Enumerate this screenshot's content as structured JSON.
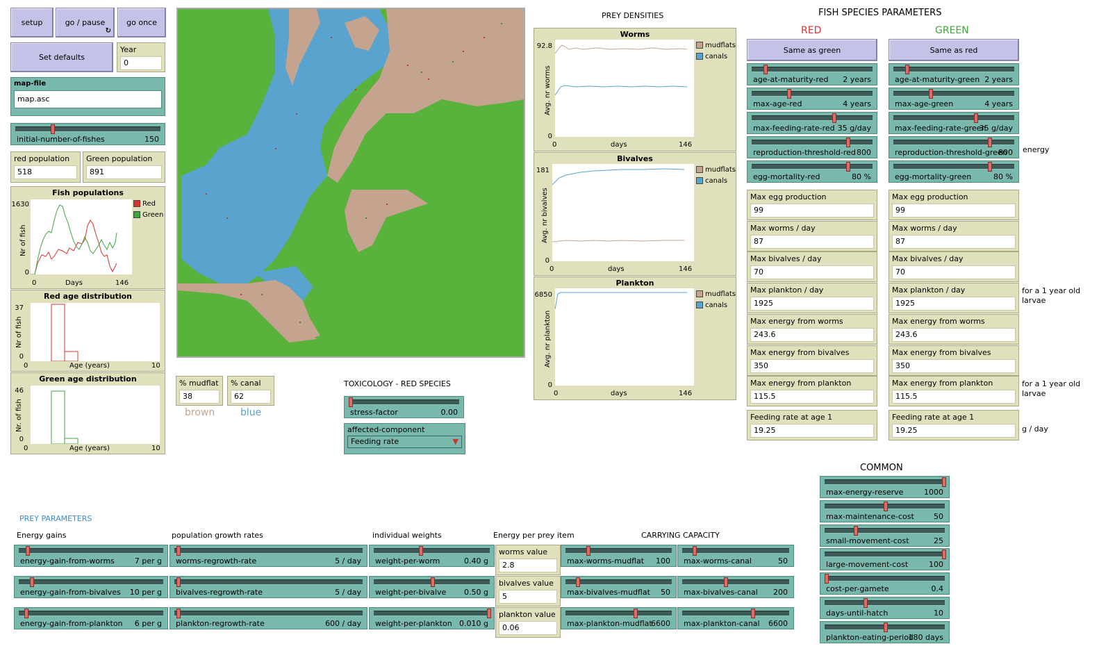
{
  "buttons": {
    "setup": "setup",
    "go_pause": "go / pause",
    "go_once": "go once",
    "set_defaults": "Set defaults",
    "same_as_green": "Same as green",
    "same_as_red": "Same as red"
  },
  "year": {
    "label": "Year",
    "value": "0"
  },
  "map_file": {
    "label": "map-file",
    "value": "map.asc"
  },
  "initial_fishes": {
    "label": "initial-number-of-fishes",
    "value": "150",
    "fraction": 0.25
  },
  "red_population": {
    "label": "red population",
    "value": "518"
  },
  "green_population": {
    "label": "Green population",
    "value": "891"
  },
  "fish_plot": {
    "title": "Fish populations",
    "ylabel": "Nr of fish",
    "xlabel": "Days",
    "ymax": "1630",
    "ymin": "0",
    "xmin": "0",
    "xmax": "146",
    "legend_red": "Red",
    "legend_green": "Green"
  },
  "red_age": {
    "title": "Red age distribution",
    "ylabel": "Nr of fish",
    "xlabel": "Age (years)",
    "ymax": "37",
    "ymin": "0",
    "xmin": "0",
    "xmax": "10"
  },
  "green_age": {
    "title": "Green age distribution",
    "ylabel": "Nr. of fish",
    "xlabel": "Age (years)",
    "ymax": "46",
    "ymin": "0",
    "xmin": "0",
    "xmax": "10"
  },
  "mudflat": {
    "label": "% mudflat",
    "value": "38",
    "caption": "brown"
  },
  "canal": {
    "label": "% canal",
    "value": "62",
    "caption": "blue"
  },
  "toxicology": {
    "title": "TOXICOLOGY - RED SPECIES",
    "stress_label": "stress-factor",
    "stress_value": "0.00",
    "stress_fraction": 0.0,
    "affected_label": "affected-component",
    "affected_value": "Feeding rate"
  },
  "prey_densities_title": "PREY DENSITIES",
  "worms_plot": {
    "title": "Worms",
    "ylabel": "Avg. nr worms",
    "xlabel": "days",
    "ymax": "92.8",
    "ymin": "0",
    "xmin": "0",
    "xmax": "146"
  },
  "bivalves_plot": {
    "title": "Bivalves",
    "ylabel": "Avg. nr bivalves",
    "xlabel": "days",
    "ymax": "181",
    "ymin": "0",
    "xmin": "0",
    "xmax": "146"
  },
  "plankton_plot": {
    "title": "Plankton",
    "ylabel": "Avg. nr plankton",
    "xlabel": "days",
    "ymax": "6850",
    "ymin": "0",
    "xmin": "0",
    "xmax": "146"
  },
  "prey_legend": {
    "mudflats": "mudflats",
    "canals": "canals"
  },
  "fish_params": {
    "title": "FISH SPECIES PARAMETERS",
    "red_header": "RED",
    "green_header": "GREEN",
    "red_sliders": [
      {
        "label": "age-at-maturity-red",
        "value": "2 years",
        "fraction": 0.1
      },
      {
        "label": "max-age-red",
        "value": "4 years",
        "fraction": 0.3
      },
      {
        "label": "max-feeding-rate-red",
        "value": "35 g/day",
        "fraction": 0.68
      },
      {
        "label": "reproduction-threshold-red",
        "value": "800",
        "fraction": 0.8
      },
      {
        "label": "egg-mortality-red",
        "value": "80 %",
        "fraction": 0.8
      }
    ],
    "green_sliders": [
      {
        "label": "age-at-maturity-green",
        "value": "2 years",
        "fraction": 0.1
      },
      {
        "label": "max-age-green",
        "value": "4 years",
        "fraction": 0.3
      },
      {
        "label": "max-feeding-rate-green",
        "value": "35 g/day",
        "fraction": 0.68
      },
      {
        "label": "reproduction-threshold-green",
        "value": "800",
        "fraction": 0.8
      },
      {
        "label": "egg-mortality-green",
        "value": "80 %",
        "fraction": 0.8
      }
    ],
    "red_monitors": [
      {
        "label": "Max egg production",
        "value": "99"
      },
      {
        "label": "Max worms / day",
        "value": "87"
      },
      {
        "label": "Max bivalves / day",
        "value": "70"
      },
      {
        "label": "Max plankton / day",
        "value": "1925"
      },
      {
        "label": "Max energy from worms",
        "value": "243.6"
      },
      {
        "label": "Max energy from bivalves",
        "value": "350"
      },
      {
        "label": "Max energy from plankton",
        "value": "115.5"
      }
    ],
    "green_monitors": [
      {
        "label": "Max egg production",
        "value": "99"
      },
      {
        "label": "Max worms / day",
        "value": "87"
      },
      {
        "label": "Max bivalves / day",
        "value": "70"
      },
      {
        "label": "Max plankton / day",
        "value": "1925"
      },
      {
        "label": "Max energy from worms",
        "value": "243.6"
      },
      {
        "label": "Max energy from bivalves",
        "value": "350"
      },
      {
        "label": "Max energy from plankton",
        "value": "115.5"
      }
    ],
    "red_feeding": {
      "label": "Feeding rate at age 1",
      "value": "19.25"
    },
    "green_feeding": {
      "label": "Feeding rate at age 1",
      "value": "19.25"
    },
    "note_energy": "energy",
    "note_larvae1_a": "for a 1 year old",
    "note_larvae1_b": "larvae",
    "note_larvae2_a": "for a 1 year old",
    "note_larvae2_b": "larvae",
    "note_gday": "g / day"
  },
  "common": {
    "title": "COMMON",
    "sliders": [
      {
        "label": "max-energy-reserve",
        "value": "1000",
        "fraction": 1.0
      },
      {
        "label": "max-maintenance-cost",
        "value": "50",
        "fraction": 0.5
      },
      {
        "label": "small-movement-cost",
        "value": "25",
        "fraction": 0.25
      },
      {
        "label": "large-movement-cost",
        "value": "100",
        "fraction": 1.0
      },
      {
        "label": "cost-per-gamete",
        "value": "0.4",
        "fraction": 0.0
      },
      {
        "label": "days-until-hatch",
        "value": "10",
        "fraction": 0.33
      },
      {
        "label": "plankton-eating-period",
        "value": "180 days",
        "fraction": 0.5
      }
    ]
  },
  "prey_params": {
    "title": "PREY PARAMETERS",
    "col_energy": "Energy gains",
    "col_growth": "population growth rates",
    "col_weights": "individual weights",
    "col_energy_item": "Energy per prey item",
    "col_carrying": "CARRYING CAPACITY",
    "energy_sliders": [
      {
        "label": "energy-gain-from-worms",
        "value": "7 per g",
        "fraction": 0.05
      },
      {
        "label": "energy-gain-from-bivalves",
        "value": "10 per g",
        "fraction": 0.08
      },
      {
        "label": "energy-gain-from-plankton",
        "value": "6 per g",
        "fraction": 0.04
      }
    ],
    "growth_sliders": [
      {
        "label": "worms-regrowth-rate",
        "value": "5 / day",
        "fraction": 0.01
      },
      {
        "label": "bivalves-regrowth-rate",
        "value": "5 / day",
        "fraction": 0.01
      },
      {
        "label": "plankton-regrowth-rate",
        "value": "600 / day",
        "fraction": 0.01
      }
    ],
    "weight_sliders": [
      {
        "label": "weight-per-worm",
        "value": "0.40 g",
        "fraction": 0.4
      },
      {
        "label": "weight-per-bivalve",
        "value": "0.50 g",
        "fraction": 0.5
      },
      {
        "label": "weight-per-plankton",
        "value": "0.010 g",
        "fraction": 1.0
      }
    ],
    "inputs": [
      {
        "label": "worms value",
        "value": "2.8"
      },
      {
        "label": "bivalves value",
        "value": "5"
      },
      {
        "label": "plankton value",
        "value": "0.06"
      }
    ],
    "mudflat_sliders": [
      {
        "label": "max-worms-mudflat",
        "value": "100",
        "fraction": 0.2
      },
      {
        "label": "max-bivalves-mudflat",
        "value": "50",
        "fraction": 0.1
      },
      {
        "label": "max-plankton-mudflat",
        "value": "6600",
        "fraction": 0.66
      }
    ],
    "canal_sliders": [
      {
        "label": "max-worms-canal",
        "value": "50",
        "fraction": 0.1
      },
      {
        "label": "max-bivalves-canal",
        "value": "200",
        "fraction": 0.4
      },
      {
        "label": "max-plankton-canal",
        "value": "6600",
        "fraction": 0.66
      }
    ]
  },
  "colors": {
    "mudflat": "#c4a48f",
    "canal": "#59a3cf",
    "land": "#59b23c",
    "red_series": "#e03030",
    "green_series": "#40a640"
  }
}
